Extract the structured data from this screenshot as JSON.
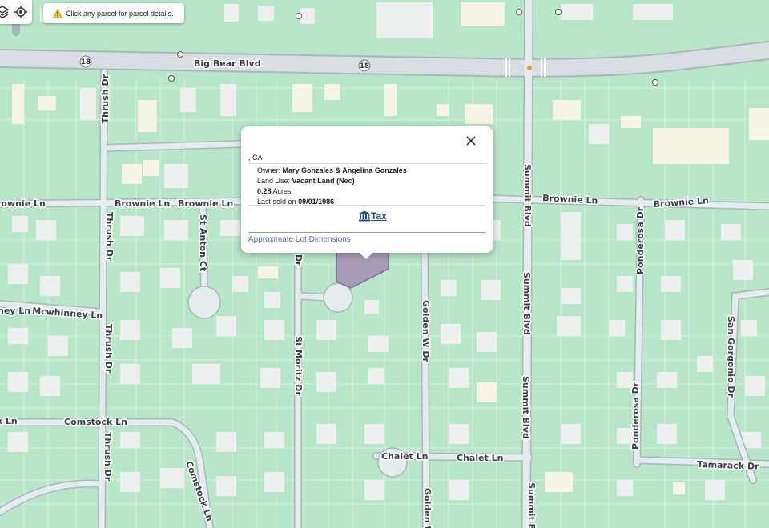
{
  "controls": {
    "layers_icon": "layers-icon",
    "locate_icon": "locate-icon"
  },
  "notice": {
    "icon": "warning-icon",
    "text": "Click any parcel for parcel details."
  },
  "streets": {
    "big_bear": "Big Bear Blvd",
    "hwy": "18",
    "brownie": "Brownie Ln",
    "brownie_left": "rownie Ln",
    "mcwhinney": "Mcwhinney Ln",
    "mcwhinney_left": "ney Ln",
    "comstock": "Comstock Ln",
    "comstock_left": "x Ln",
    "chalet": "Chalet Ln",
    "thrush": "Thrush Dr",
    "st_anton": "St Anton Ct",
    "st_moritz": "St Moritz Dr",
    "st_moritz_partial": "Dr",
    "golden": "Golden W Dr",
    "golden_partial": "Golden W",
    "summit": "Summit Blvd",
    "ponderosa": "Ponderosa Dr",
    "san_gorgonio": "San Gorgonio Dr",
    "tamarack": "Tamarack Dr"
  },
  "popup": {
    "address": ", CA",
    "owner_label": "Owner:",
    "owner": "Mary Gonzales & Angelina Gonzales",
    "land_use_label": "Land Use:",
    "land_use": "Vacant Land (Nec)",
    "acres": "0.28",
    "acres_label": "Acres",
    "sold_label": "Last sold on",
    "sold_date": "09/01/1986",
    "tax_label": "Tax",
    "tax_icon": "bank-icon",
    "lot_dimensions": "Approximate Lot Dimensions",
    "close_icon": "close-icon"
  },
  "colors": {
    "land": "#b8e6c9",
    "road": "#e6eef0",
    "highway": "#d7dde0",
    "building": "#f0f1f1",
    "selected_parcel": "#a69cb7"
  }
}
